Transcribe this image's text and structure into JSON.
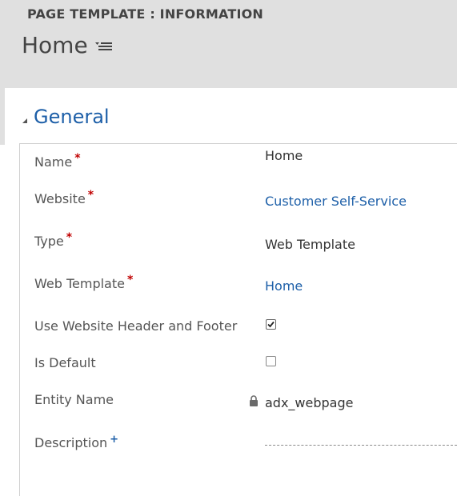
{
  "header": {
    "entity_type": "PAGE TEMPLATE : INFORMATION",
    "record_title": "Home",
    "menu_icon": "list-menu-icon"
  },
  "section": {
    "title": "General",
    "collapse_icon": "triangle-collapse-icon"
  },
  "fields": {
    "name": {
      "label": "Name",
      "required_marker": "*",
      "value": "Home"
    },
    "website": {
      "label": "Website",
      "required_marker": "*",
      "value": "Customer Self-Service"
    },
    "type": {
      "label": "Type",
      "required_marker": "*",
      "value": "Web Template"
    },
    "web_template": {
      "label": "Web Template",
      "required_marker": "*",
      "value": "Home"
    },
    "use_header_footer": {
      "label": "Use Website Header and Footer",
      "checked": true
    },
    "is_default": {
      "label": "Is Default",
      "checked": false
    },
    "entity_name": {
      "label": "Entity Name",
      "value": "adx_webpage",
      "lock_icon": "lock-icon"
    },
    "description": {
      "label": "Description",
      "recommended_marker": "+",
      "value": ""
    }
  },
  "colors": {
    "header_bg": "#e0e0e0",
    "link": "#1d5fa8",
    "required": "#c00000"
  }
}
